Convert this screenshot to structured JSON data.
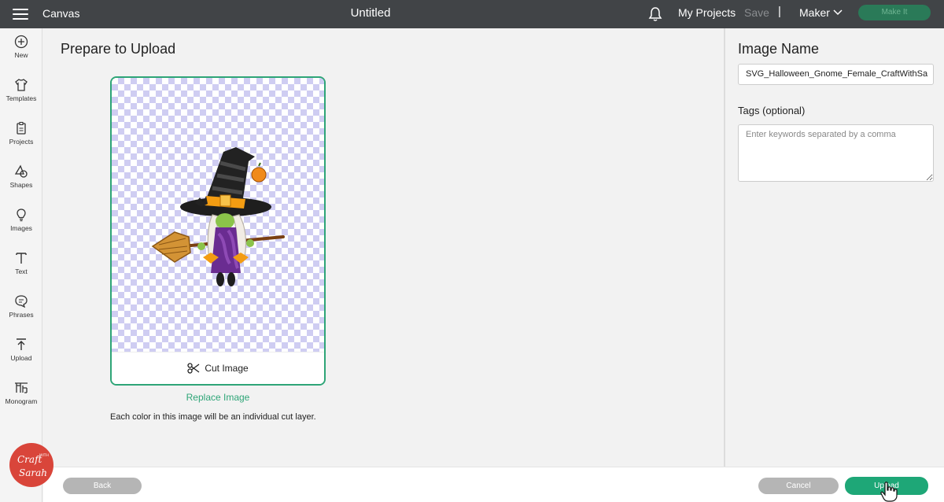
{
  "topbar": {
    "app_title": "Canvas",
    "doc_title": "Untitled",
    "my_projects": "My Projects",
    "save": "Save",
    "separator": "|",
    "machine": "Maker",
    "make_it": "Make It"
  },
  "sidebar": {
    "items": [
      {
        "label": "New",
        "icon": "plus-circle-icon"
      },
      {
        "label": "Templates",
        "icon": "shirt-icon"
      },
      {
        "label": "Projects",
        "icon": "clipboard-icon"
      },
      {
        "label": "Shapes",
        "icon": "shapes-icon"
      },
      {
        "label": "Images",
        "icon": "lightbulb-icon"
      },
      {
        "label": "Text",
        "icon": "text-icon"
      },
      {
        "label": "Phrases",
        "icon": "speech-bubble-icon"
      },
      {
        "label": "Upload",
        "icon": "upload-icon"
      },
      {
        "label": "Monogram",
        "icon": "monogram-icon"
      }
    ]
  },
  "main": {
    "title": "Prepare to Upload",
    "cut_image": "Cut Image",
    "replace_image": "Replace Image",
    "cut_note": "Each color in this image will be an individual cut layer."
  },
  "right_panel": {
    "image_name_label": "Image Name",
    "image_name_value": "SVG_Halloween_Gnome_Female_CraftWithSa",
    "tags_label": "Tags (optional)",
    "tags_placeholder": "Enter keywords separated by a comma"
  },
  "bottombar": {
    "back": "Back",
    "cancel": "Cancel",
    "upload": "Upload"
  },
  "logo": {
    "text": "Craft with Sarah"
  },
  "colors": {
    "accent": "#1ea777",
    "topbar": "#414447",
    "checker": "#cfcdf2"
  }
}
